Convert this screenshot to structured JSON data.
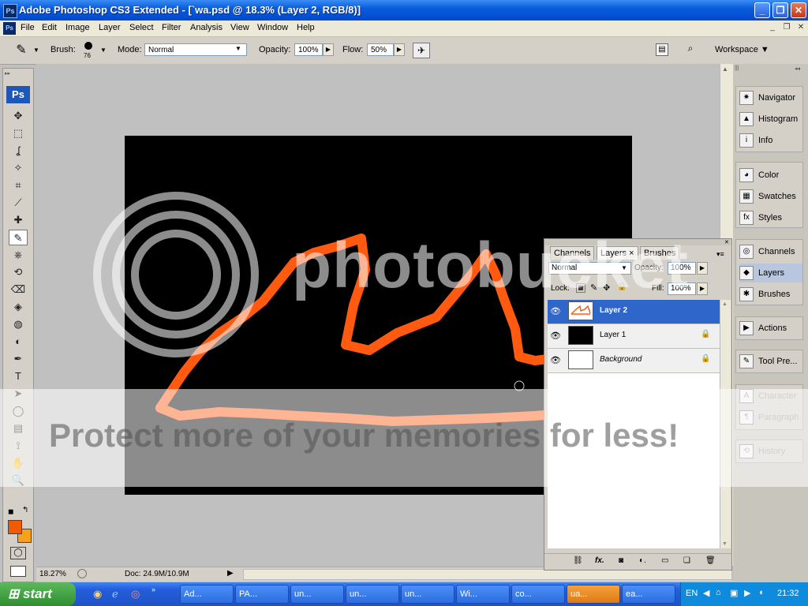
{
  "window": {
    "app_icon": "Ps",
    "title": "Adobe Photoshop CS3 Extended - [`wa.psd @ 18.3% (Layer 2, RGB/8)]",
    "btn_minimize": "_",
    "btn_restore": "❐",
    "btn_close": "✕"
  },
  "menu": {
    "icon": "Ps",
    "items": [
      "File",
      "Edit",
      "Image",
      "Layer",
      "Select",
      "Filter",
      "Analysis",
      "View",
      "Window",
      "Help"
    ],
    "mdi_min": "_",
    "mdi_restore": "❐",
    "mdi_close": "✕"
  },
  "options": {
    "brush_label": "Brush:",
    "brush_size": "76",
    "mode_label": "Mode:",
    "mode_value": "Normal",
    "opacity_label": "Opacity:",
    "opacity_value": "100%",
    "flow_label": "Flow:",
    "flow_value": "50%",
    "workspace_label": "Workspace ▼"
  },
  "toolbox": {
    "logo": "Ps",
    "icons": [
      "move-tool-icon",
      "marquee-tool-icon",
      "lasso-tool-icon",
      "magic-wand-icon",
      "crop-tool-icon",
      "slice-tool-icon",
      "healing-brush-icon",
      "brush-tool-icon",
      "clone-stamp-icon",
      "history-brush-icon",
      "eraser-tool-icon",
      "paint-bucket-icon",
      "blur-tool-icon",
      "dodge-tool-icon",
      "pen-tool-icon",
      "type-tool-icon",
      "path-select-icon",
      "shape-tool-icon",
      "notes-tool-icon",
      "eyedropper-icon",
      "hand-tool-icon",
      "zoom-tool-icon"
    ],
    "glyphs": [
      "✥",
      "⬚",
      "ʆ",
      "✧",
      "⌗",
      "⟋",
      "✚",
      "✎",
      "⎈",
      "⟲",
      "⌫",
      "◈",
      "◍",
      "◐",
      "✒",
      "T",
      "➤",
      "◯",
      "▤",
      "⟟",
      "✋",
      "🔍"
    ],
    "fg_color": "#f25a00",
    "bg_color": "#f7a11a"
  },
  "status": {
    "zoom": "18.27%",
    "doc": "Doc: 24.9M/10.9M"
  },
  "dock": {
    "group1": [
      {
        "label": "Navigator",
        "icon": "navigator-icon",
        "glyph": "✷"
      },
      {
        "label": "Histogram",
        "icon": "histogram-icon",
        "glyph": "▲"
      },
      {
        "label": "Info",
        "icon": "info-icon",
        "glyph": "i"
      }
    ],
    "group2": [
      {
        "label": "Color",
        "icon": "color-icon",
        "glyph": "◕"
      },
      {
        "label": "Swatches",
        "icon": "swatches-icon",
        "glyph": "▦"
      },
      {
        "label": "Styles",
        "icon": "styles-icon",
        "glyph": "fx"
      }
    ],
    "group3": [
      {
        "label": "Channels",
        "icon": "channels-icon",
        "glyph": "◎"
      },
      {
        "label": "Layers",
        "icon": "layers-icon",
        "glyph": "◆"
      },
      {
        "label": "Brushes",
        "icon": "brushes-icon",
        "glyph": "✱"
      }
    ],
    "group4": [
      {
        "label": "Actions",
        "icon": "actions-icon",
        "glyph": "▶"
      }
    ],
    "group5": [
      {
        "label": "Tool Pre...",
        "icon": "tool-presets-icon",
        "glyph": "✎"
      }
    ],
    "group6": [
      {
        "label": "Character",
        "icon": "character-icon",
        "glyph": "A"
      },
      {
        "label": "Paragraph",
        "icon": "paragraph-icon",
        "glyph": "¶"
      }
    ],
    "group7": [
      {
        "label": "History",
        "icon": "history-icon",
        "glyph": "⟲"
      }
    ]
  },
  "layers_panel": {
    "tabs": [
      "Channels",
      "Layers",
      "Brushes"
    ],
    "tab_close": "×",
    "blend_mode": "Normal",
    "opacity_label": "Opacity:",
    "opacity_value": "100%",
    "lock_label": "Lock:",
    "fill_label": "Fill:",
    "fill_value": "100%",
    "layers": [
      {
        "name": "Layer 2",
        "selected": true
      },
      {
        "name": "Layer 1",
        "selected": false
      },
      {
        "name": "Background",
        "selected": false
      }
    ]
  },
  "watermark": {
    "brand": "photobucket",
    "tagline": "Protect more of your memories for less!"
  },
  "taskbar": {
    "start": "start",
    "buttons": [
      "Ad...",
      "PA...",
      "un...",
      "un...",
      "un...",
      "Wi...",
      "co...",
      "ua...",
      "ea..."
    ],
    "lang": "EN",
    "clock": "21:32"
  }
}
